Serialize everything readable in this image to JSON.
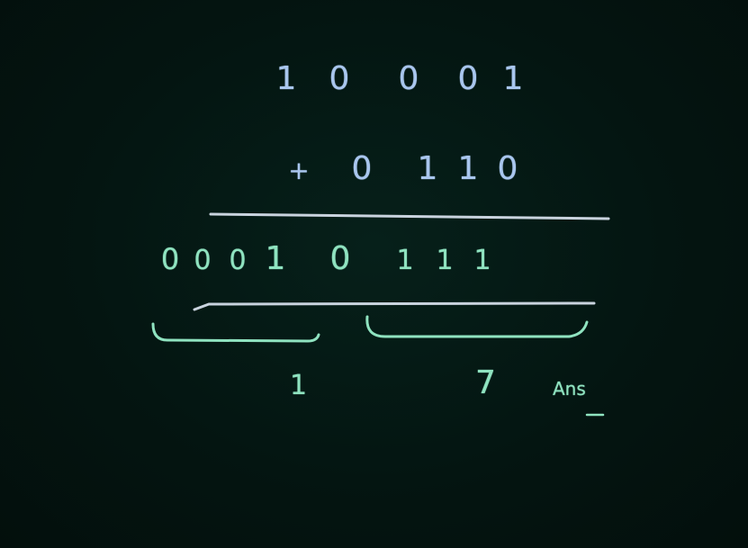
{
  "board": {
    "row1": [
      "1",
      "0",
      "0",
      "0",
      "1"
    ],
    "row2": [
      "+",
      "0",
      "1",
      "1",
      "0"
    ],
    "row3": [
      "0",
      "0",
      "0",
      "1",
      "0",
      "1",
      "1",
      "1"
    ],
    "group_labels": [
      "1",
      "7"
    ],
    "answer_label": "Ans",
    "colors": {
      "background": "#041410",
      "chalk_blue": "#a9c6ee",
      "chalk_green": "#8fe3c0",
      "chalk_white": "#d6dde6"
    }
  }
}
